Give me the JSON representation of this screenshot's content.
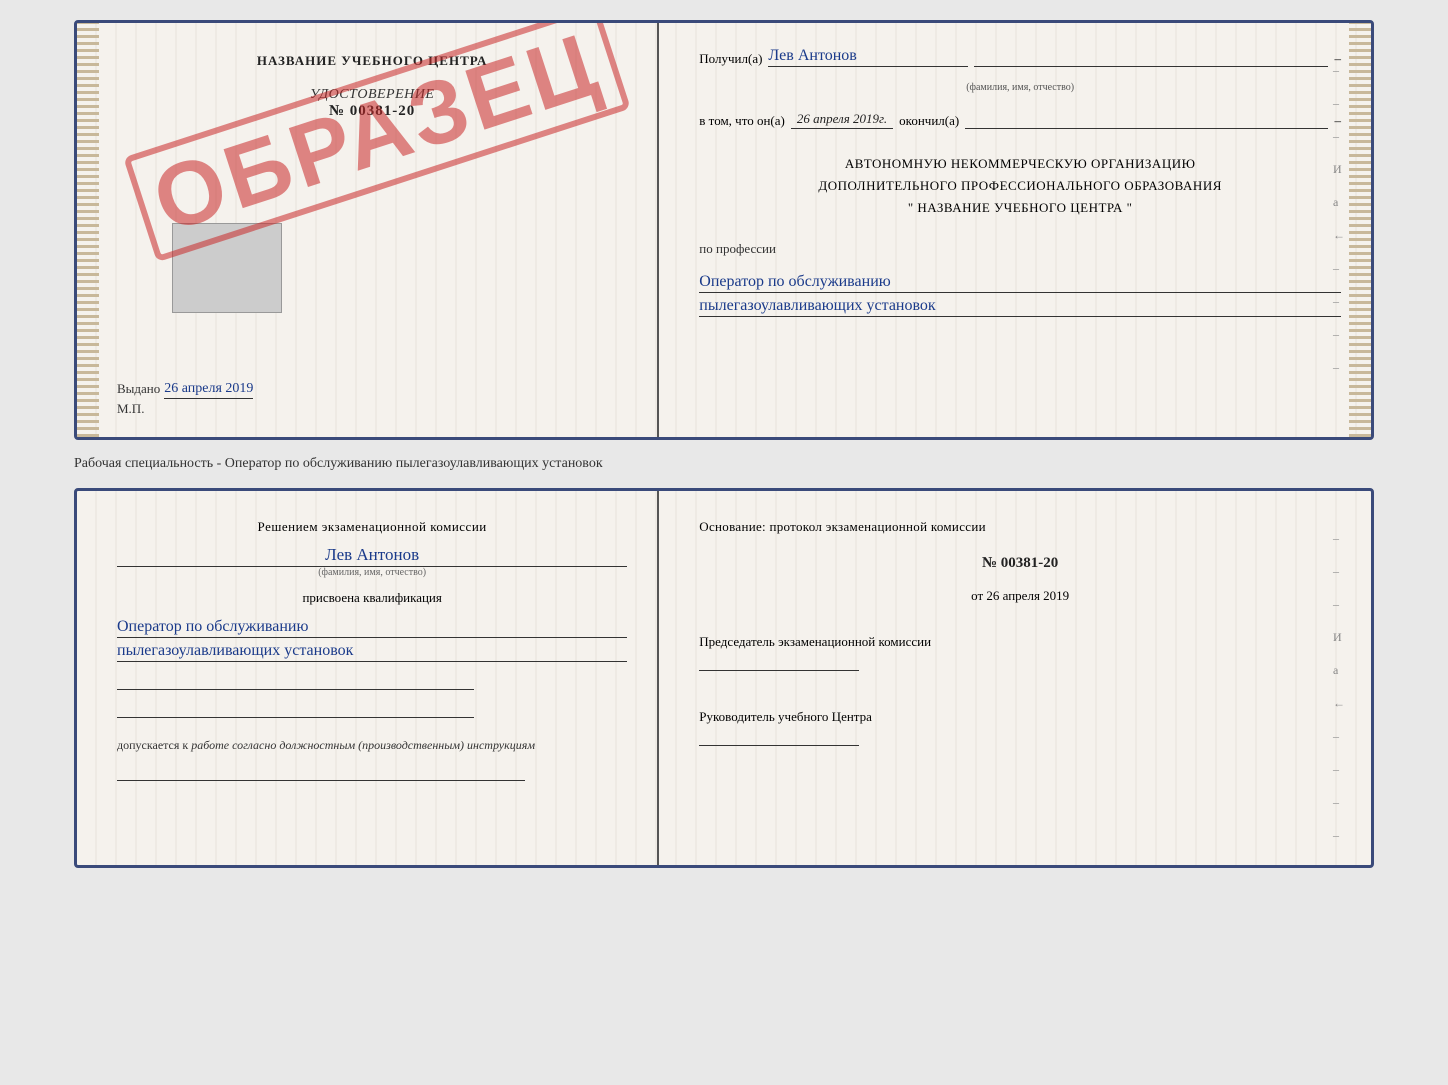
{
  "top_cert": {
    "left": {
      "title": "НАЗВАНИЕ УЧЕБНОГО ЦЕНТРА",
      "stamp": "ОБРАЗЕЦ",
      "udostoverenie_label": "УДОСТОВЕРЕНИЕ",
      "number": "№ 00381-20",
      "vydano_label": "Выдано",
      "vydano_date": "26 апреля 2019",
      "mp": "М.П."
    },
    "right": {
      "poluchil_label": "Получил(а)",
      "recipient_name": "Лев Антонов",
      "fio_sub": "(фамилия, имя, отчество)",
      "vtom_label": "в том, что он(а)",
      "date_value": "26 апреля 2019г.",
      "okochil_label": "окончил(а)",
      "org_line1": "АВТОНОМНУЮ НЕКОММЕРЧЕСКУЮ ОРГАНИЗАЦИЮ",
      "org_line2": "ДОПОЛНИТЕЛЬНОГО ПРОФЕССИОНАЛЬНОГО ОБРАЗОВАНИЯ",
      "org_name": "\"  НАЗВАНИЕ УЧЕБНОГО ЦЕНТРА  \"",
      "po_professii": "по профессии",
      "profession_line1": "Оператор по обслуживанию",
      "profession_line2": "пылегазоулавливающих установок"
    }
  },
  "separator": {
    "text": "Рабочая специальность - Оператор по обслуживанию пылегазоулавливающих установок"
  },
  "bottom_cert": {
    "left": {
      "resheniem_label": "Решением экзаменационной комиссии",
      "person_name": "Лев Антонов",
      "fio_sub": "(фамилия, имя, отчество)",
      "prisvoyena_label": "присвоена квалификация",
      "qual_line1": "Оператор по обслуживанию",
      "qual_line2": "пылегазоулавливающих установок",
      "dopusk_label": "допускается к",
      "dopusk_value": "работе согласно должностным (производственным) инструкциям"
    },
    "right": {
      "osnovanie_label": "Основание: протокол экзаменационной комиссии",
      "protocol_number": "№ 00381-20",
      "ot_label": "от",
      "ot_date": "26 апреля 2019",
      "predsedatel_label": "Председатель экзаменационной комиссии",
      "rukovoditel_label": "Руководитель учебного Центра"
    }
  },
  "edge_marks": {
    "items": [
      "–",
      "–",
      "–",
      "И",
      "а",
      "←",
      "–",
      "–",
      "–",
      "–"
    ]
  }
}
